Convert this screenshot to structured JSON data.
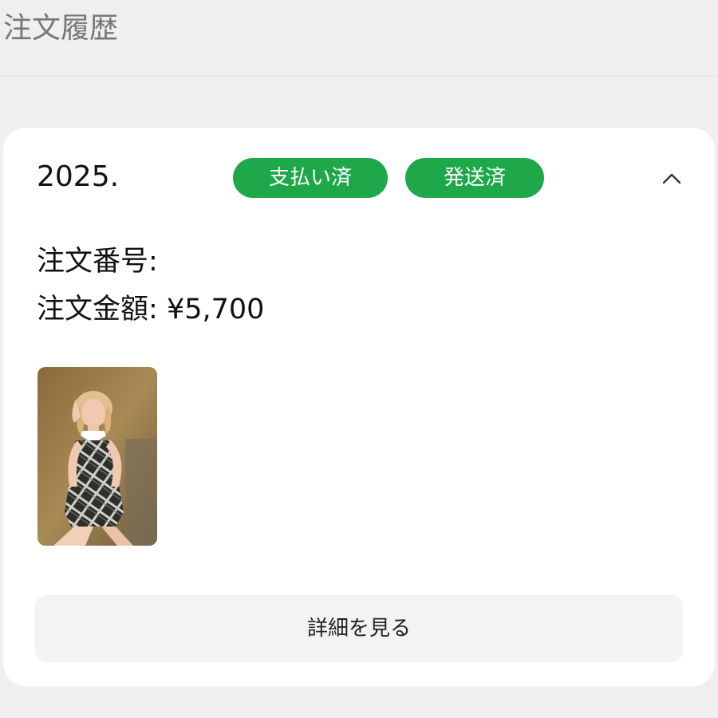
{
  "header": {
    "title": "注文履歴"
  },
  "order": {
    "date": "2025.",
    "badges": [
      {
        "label": "支払い済",
        "color": "#1ea84a"
      },
      {
        "label": "発送済",
        "color": "#1ea84a"
      }
    ],
    "toggle_icon": "chevron-up-icon",
    "order_number_label": "注文番号:",
    "order_number_value": "",
    "amount_label": "注文金額:",
    "amount_value": "¥5,700",
    "item_image": "product-photo-person-in-plaid-dress",
    "details_button_label": "詳細を見る"
  },
  "colors": {
    "page_background": "#efefef",
    "card_background": "#ffffff",
    "badge_green": "#1ea84a",
    "button_background": "#f3f3f3"
  }
}
